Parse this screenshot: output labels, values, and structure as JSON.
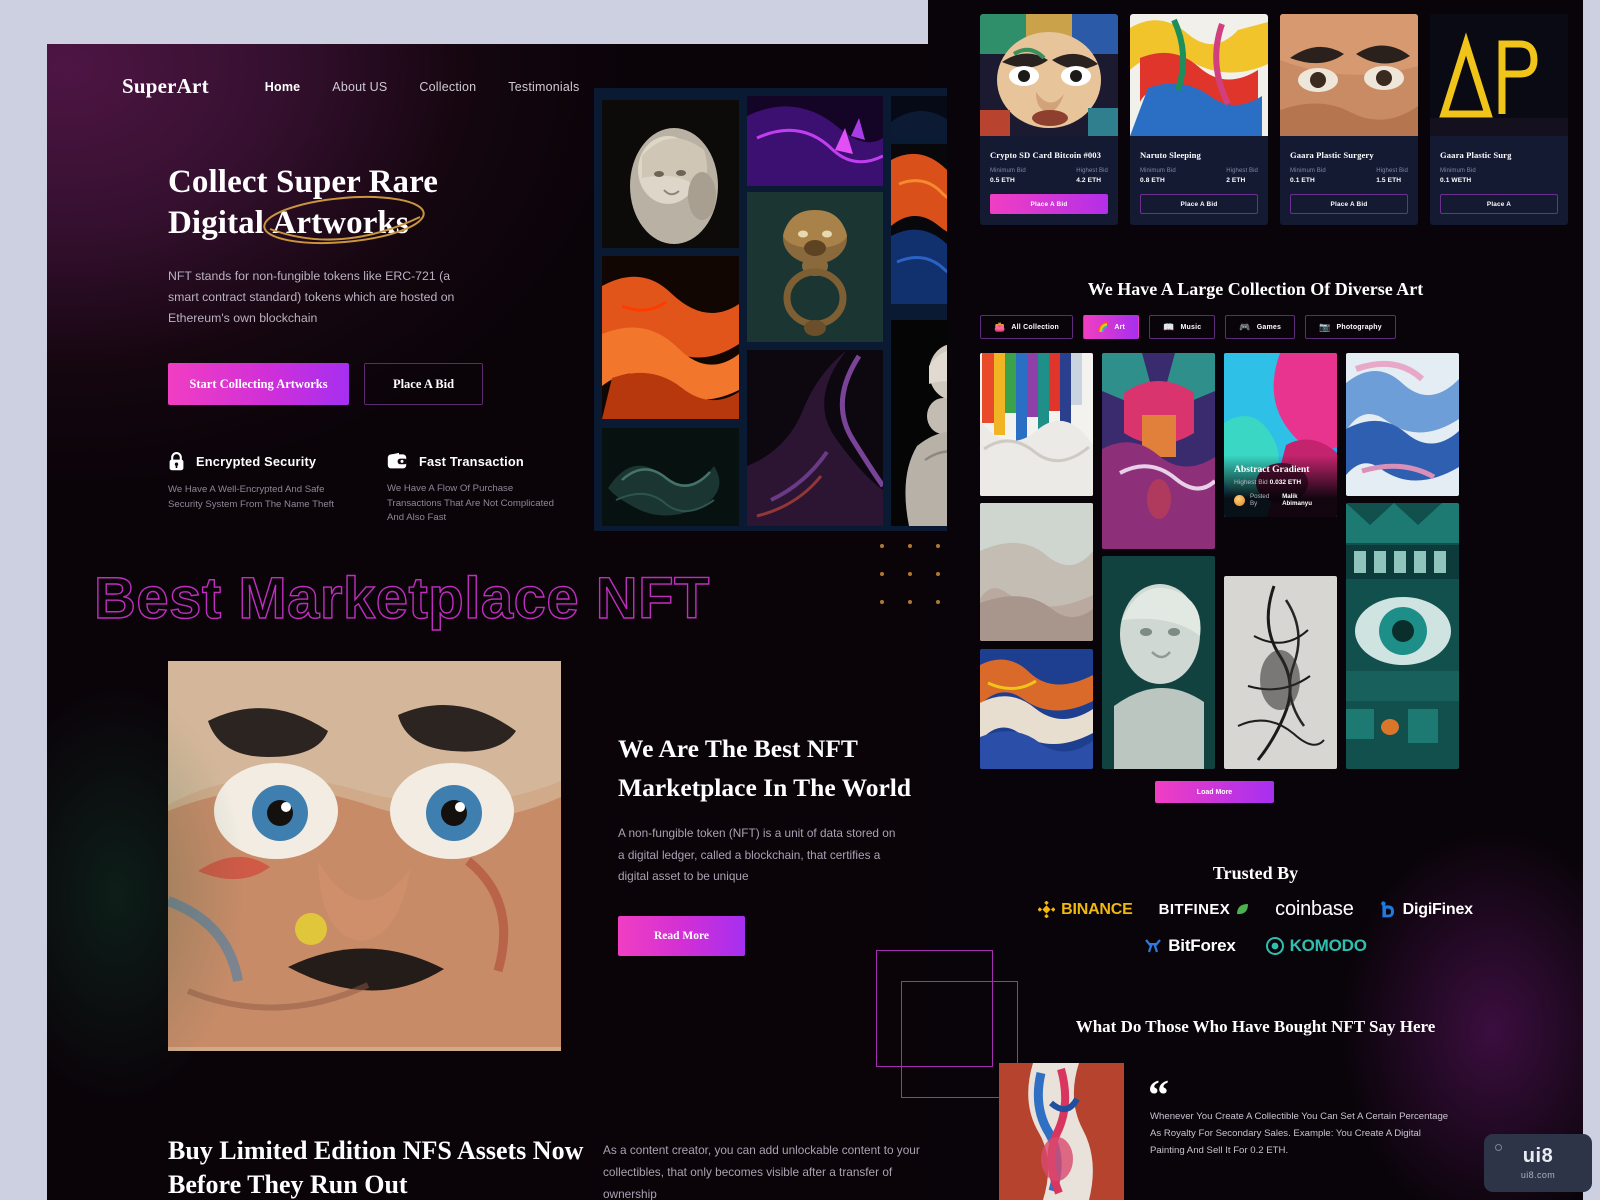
{
  "left": {
    "brand": "SuperArt",
    "nav": [
      {
        "label": "Home",
        "active": true
      },
      {
        "label": "About US",
        "active": false
      },
      {
        "label": "Collection",
        "active": false
      },
      {
        "label": "Testimonials",
        "active": false
      }
    ],
    "hero": {
      "title_line1": "Collect Super Rare",
      "title_line2_pre": "Digital ",
      "title_line2_hl": "Artworks",
      "subtitle": "NFT stands for non-fungible tokens like ERC-721 (a smart contract standard) tokens which are hosted on Ethereum's own blockchain",
      "btn_primary": "Start Collecting Artworks",
      "btn_secondary": "Place A Bid"
    },
    "features": [
      {
        "icon": "lock-icon",
        "title": "Encrypted Security",
        "desc": "We Have A Well-Encrypted And Safe Security System From The Name Theft"
      },
      {
        "icon": "wallet-icon",
        "title": "Fast Transaction",
        "desc": "We Have A Flow Of Purchase Transactions That Are Not Complicated And Also Fast"
      }
    ],
    "outline_text": "Best Marketplace NFT",
    "best": {
      "title": "We Are The Best NFT Marketplace In The World",
      "desc": "A non-fungible token (NFT) is a unit of data stored on a digital ledger, called a blockchain, that certifies a digital asset to be unique",
      "btn": "Read More"
    },
    "limited": {
      "title": "Buy Limited Edition NFS Assets Now Before They Run Out",
      "desc": "As a content creator, you can add unlockable content to your collectibles, that only becomes visible after a transfer of ownership"
    }
  },
  "right": {
    "cards": [
      {
        "name": "Crypto SD Card Bitcoin #003",
        "min_label": "Minimum Bid",
        "min_value": "0.5 ETH",
        "high_label": "Highest Bid",
        "high_value": "4.2 ETH",
        "btn": "Place A Bid",
        "style": "solid"
      },
      {
        "name": "Naruto Sleeping",
        "min_label": "Minimum Bid",
        "min_value": "0.8 ETH",
        "high_label": "Highest Bid",
        "high_value": "2 ETH",
        "btn": "Place A Bid",
        "style": "ghost"
      },
      {
        "name": "Gaara Plastic Surgery",
        "min_label": "Minimum Bid",
        "min_value": "0.1 ETH",
        "high_label": "Highest Bid",
        "high_value": "1.5 ETH",
        "btn": "Place A Bid",
        "style": "ghost"
      },
      {
        "name": "Gaara Plastic Surg",
        "min_label": "Minimum Bid",
        "min_value": "0.1 WETH",
        "high_label": "",
        "high_value": "",
        "btn": "Place A",
        "style": "ghost"
      }
    ],
    "collection_heading": "We Have A Large Collection Of Diverse Art",
    "chips": [
      {
        "label": "All Collection",
        "emoji": "👛",
        "active": false
      },
      {
        "label": "Art",
        "emoji": "🌈",
        "active": true
      },
      {
        "label": "Music",
        "emoji": "📖",
        "active": false
      },
      {
        "label": "Games",
        "emoji": "🎮",
        "active": false
      },
      {
        "label": "Photography",
        "emoji": "📷",
        "active": false
      }
    ],
    "featured_art": {
      "title": "Abstract Gradient",
      "bid_label": "Highest Bid",
      "bid_value": "0.032 ETH",
      "posted_label": "Posted By",
      "posted_by": "Malik Abimanyu"
    },
    "load_more": "Load More",
    "trusted_heading": "Trusted By",
    "logos_row1": [
      {
        "name": "BINANCE",
        "color": "#f0b90b",
        "icon": "binance-icon"
      },
      {
        "name": "BITFINEX",
        "color": "#ffffff",
        "icon": "bitfinex-leaf-icon"
      },
      {
        "name": "coinbase",
        "color": "#ffffff",
        "icon": "coinbase-icon"
      },
      {
        "name": "DigiFinex",
        "color": "#ffffff",
        "icon": "digifinex-icon"
      }
    ],
    "logos_row2": [
      {
        "name": "BitForex",
        "color": "#ffffff",
        "icon": "bitforex-icon"
      },
      {
        "name": "KOMODO",
        "color": "#2fbfb0",
        "icon": "komodo-icon"
      }
    ],
    "testimonial_heading": "What Do Those Who Have Bought NFT Say Here",
    "testimonial_quote": "Whenever You Create A Collectible You Can Set A Certain Percentage As Royalty For Secondary Sales. Example: You Create A Digital Painting And Sell It For 0.2 ETH."
  },
  "watermark": {
    "main": "ui8",
    "sub": "ui8.com"
  }
}
